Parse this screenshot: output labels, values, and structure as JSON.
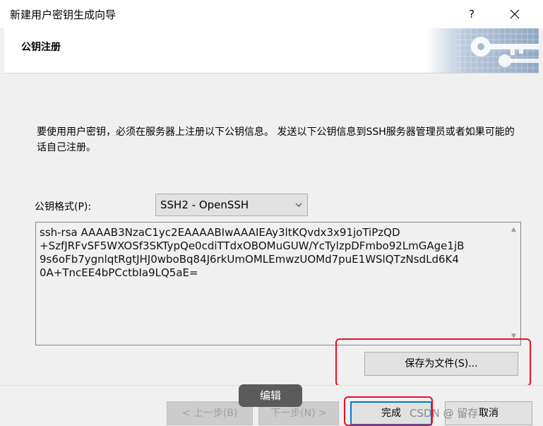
{
  "window": {
    "title": "新建用户密钥生成向导",
    "help_label": "?",
    "close_icon": "close-icon"
  },
  "header": {
    "title": "公钥注册",
    "banner_icon": "key-banner-icon"
  },
  "description": "要使用用户密钥，必须在服务器上注册以下公钥信息。 发送以下公钥信息到SSH服务器管理员或者如果可能的话自己注册。",
  "format": {
    "label": "公钥格式(P):",
    "selected": "SSH2 - OpenSSH"
  },
  "public_key": "ssh-rsa AAAAB3NzaC1yc2EAAAABIwAAAIEAy3ltKQvdx3x91joTiPzQD\n+SzfJRFvSF5WXOSf3SKTypQe0cdiTTdxOBOMuGUW/YcTylzpDFmbo92LmGAge1jB\n9s6oFb7ygnlqtRgtJHJ0wboBq84J6rkUmOMLEmwzUOMd7puE1WSlQTzNsdLd6K4\n0A+TncEE4bPCctbIa9LQ5aE=",
  "buttons": {
    "save": "保存为文件(S)...",
    "back": "< 上一步(B)",
    "next": "下一步(N) >",
    "finish": "完成",
    "cancel": "取消"
  },
  "overlay": {
    "edit_tooltip": "编辑",
    "watermark": "CSDN @ 留存"
  },
  "colors": {
    "highlight_red": "#e81123",
    "accent_blue": "#0078d7"
  }
}
